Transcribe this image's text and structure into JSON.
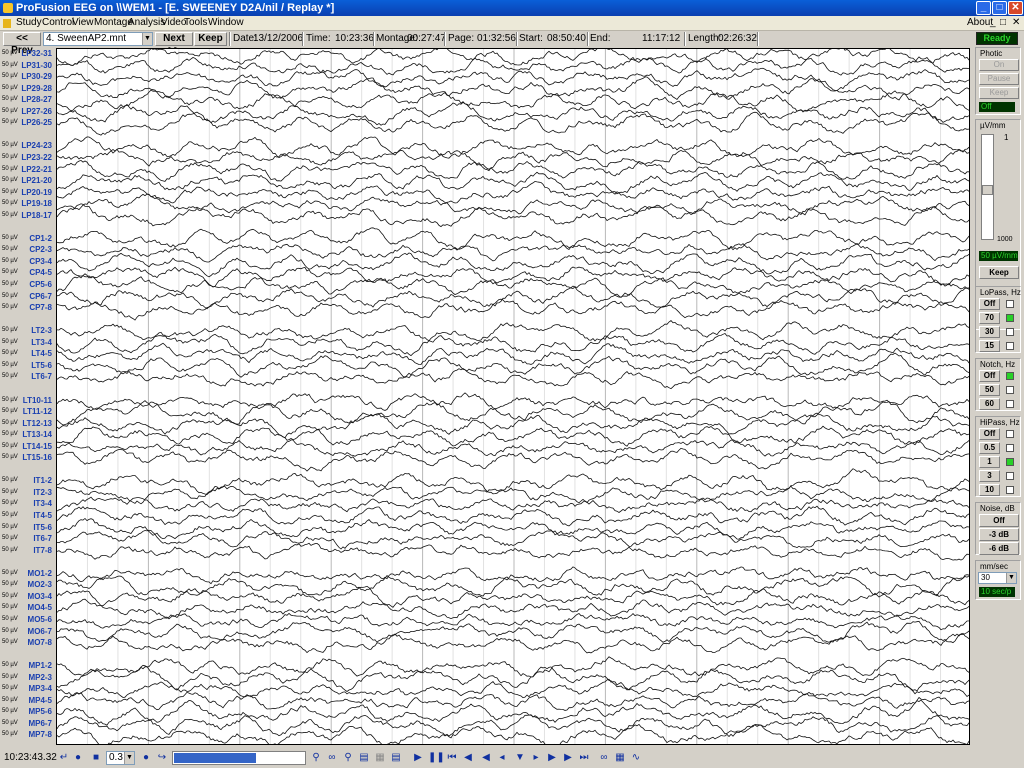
{
  "window": {
    "title": "ProFusion EEG on \\\\WEM1 - [E. SWEENEY D2A/nil / Replay *]",
    "minimize": "_",
    "maximize": "□",
    "close": "✕"
  },
  "menu": {
    "items": [
      "Study",
      "Control",
      "View",
      "Montage",
      "Analysis",
      "Video",
      "Tools",
      "Window"
    ],
    "about": "About",
    "mdi": [
      "_",
      "□",
      "✕"
    ]
  },
  "toolbar": {
    "prev_label": "<< Prev",
    "montage": "4. SweenAP2.mnt",
    "next_label": "Next >>",
    "keep_label": "Keep",
    "date_label": "Date:",
    "date": "13/12/2006",
    "time_label": "Time:",
    "time": "10:23:36",
    "montage_label": "Montage:",
    "montage_time": "00:27:47",
    "page_label": "Page:",
    "page": "01:32:56",
    "start_label": "Start:",
    "start": "08:50:40",
    "end_label": "End:",
    "end": "11:17:12",
    "length_label": "Length:",
    "length": "02:26:32",
    "status": "Ready"
  },
  "channels": {
    "scale": "50 µV",
    "groups": [
      [
        "LP32-31",
        "LP31-30",
        "LP30-29",
        "LP29-28",
        "LP28-27",
        "LP27-26",
        "LP26-25"
      ],
      [
        "LP24-23",
        "LP23-22",
        "LP22-21",
        "LP21-20",
        "LP20-19",
        "LP19-18",
        "LP18-17"
      ],
      [
        "CP1-2",
        "CP2-3",
        "CP3-4",
        "CP4-5",
        "CP5-6",
        "CP6-7",
        "CP7-8"
      ],
      [
        "LT2-3",
        "LT3-4",
        "LT4-5",
        "LT5-6",
        "LT6-7"
      ],
      [
        "LT10-11",
        "LT11-12",
        "LT12-13",
        "LT13-14",
        "LT14-15",
        "LT15-16"
      ],
      [
        "IT1-2",
        "IT2-3",
        "IT3-4",
        "IT4-5",
        "IT5-6",
        "IT6-7",
        "IT7-8"
      ],
      [
        "MO1-2",
        "MO2-3",
        "MO3-4",
        "MO4-5",
        "MO5-6",
        "MO6-7",
        "MO7-8"
      ],
      [
        "MP1-2",
        "MP2-3",
        "MP3-4",
        "MP4-5",
        "MP5-6",
        "MP6-7",
        "MP7-8"
      ]
    ]
  },
  "panel": {
    "photic": {
      "title": "Photic",
      "on": "On",
      "pause": "Pause",
      "keep": "Keep",
      "status": "Off"
    },
    "sensitivity": {
      "title": "µV/mm",
      "top": "1",
      "bottom": "1000",
      "value": "50 µV/mm",
      "keep": "Keep"
    },
    "lopass": {
      "title": "LoPass, Hz",
      "options": [
        "Off",
        "70",
        "30",
        "15"
      ],
      "selected": "70"
    },
    "notch": {
      "title": "Notch, Hz",
      "options": [
        "Off",
        "50",
        "60"
      ],
      "selected": "Off"
    },
    "hipass": {
      "title": "HiPass, Hz",
      "options": [
        "Off",
        "0.5",
        "1",
        "3",
        "10"
      ],
      "selected": "1"
    },
    "noise": {
      "title": "Noise, dB",
      "options": [
        "Off",
        "-3 dB",
        "-6 dB"
      ]
    },
    "speed": {
      "title": "mm/sec",
      "value": "30",
      "display": "10 sec/p"
    }
  },
  "bottom": {
    "time": "10:23:43.32",
    "step": "0.3"
  },
  "colors": {
    "title_blue": "#0a4fc8",
    "label_blue": "#1a3fb0",
    "led_green": "#2bd42b",
    "led_bg": "#003300",
    "scroll_blue": "#3565c7"
  }
}
